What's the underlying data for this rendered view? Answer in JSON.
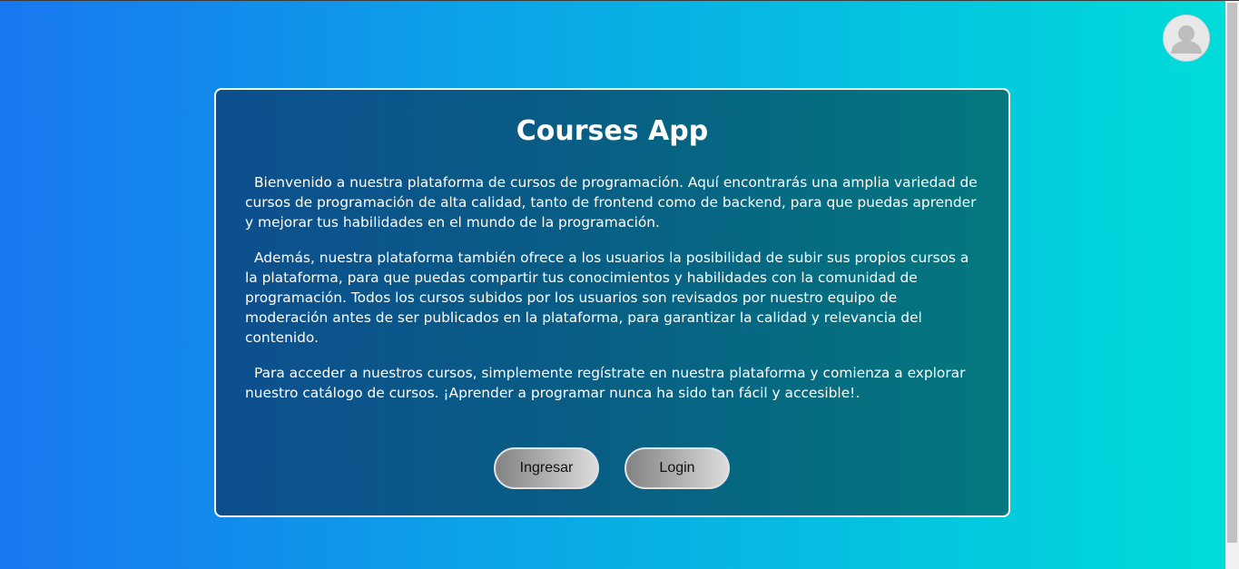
{
  "header": {
    "avatar_icon": "user-avatar-icon"
  },
  "main": {
    "title": "Courses App",
    "paragraphs": [
      "Bienvenido a nuestra plataforma de cursos de programación. Aquí encontrarás una amplia variedad de cursos de programación de alta calidad, tanto de frontend como de backend, para que puedas aprender y mejorar tus habilidades en el mundo de la programación.",
      "Además, nuestra plataforma también ofrece a los usuarios la posibilidad de subir sus propios cursos a la plataforma, para que puedas compartir tus conocimientos y habilidades con la comunidad de programación. Todos los cursos subidos por los usuarios son revisados por nuestro equipo de moderación antes de ser publicados en la plataforma, para garantizar la calidad y relevancia del contenido.",
      "Para acceder a nuestros cursos, simplemente regístrate en nuestra plataforma y comienza a explorar nuestro catálogo de cursos. ¡Aprender a programar nunca ha sido tan fácil y accesible!."
    ],
    "buttons": {
      "ingresar_label": "Ingresar",
      "login_label": "Login"
    }
  },
  "colors": {
    "background_start": "#1877f0",
    "background_end": "#00dcd9",
    "card_start": "#0d4f8e",
    "card_end": "#04787e",
    "card_border": "#ffffff"
  }
}
